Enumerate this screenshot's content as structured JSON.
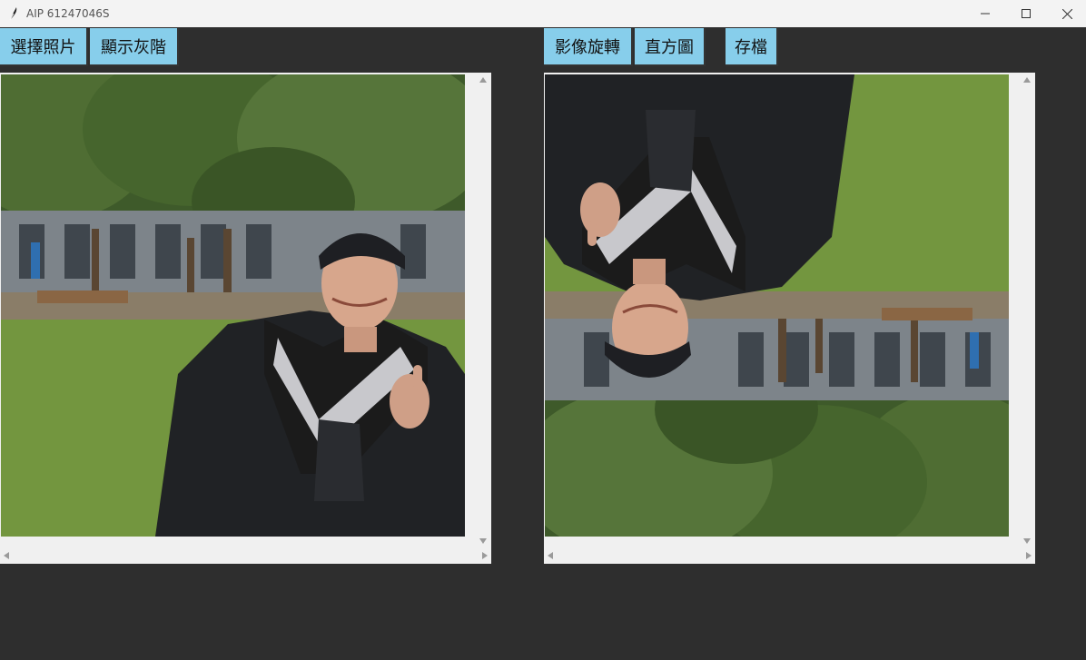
{
  "window": {
    "title": "AIP 61247046S"
  },
  "toolbar": {
    "select_photo": "選擇照片",
    "show_gray": "顯示灰階",
    "rotate": "影像旋轉",
    "histogram": "直方圖",
    "save": "存檔"
  },
  "panels": {
    "left": {
      "image": "graduation-photo",
      "rotation_deg": 0
    },
    "right": {
      "image": "graduation-photo",
      "rotation_deg": 180
    }
  },
  "colors": {
    "button": "#87ceeb",
    "background": "#2e2e2e",
    "titlebar": "#f3f3f3"
  },
  "icons": {
    "app": "feather-icon",
    "minimize": "minimize-icon",
    "maximize": "maximize-icon",
    "close": "close-icon"
  }
}
